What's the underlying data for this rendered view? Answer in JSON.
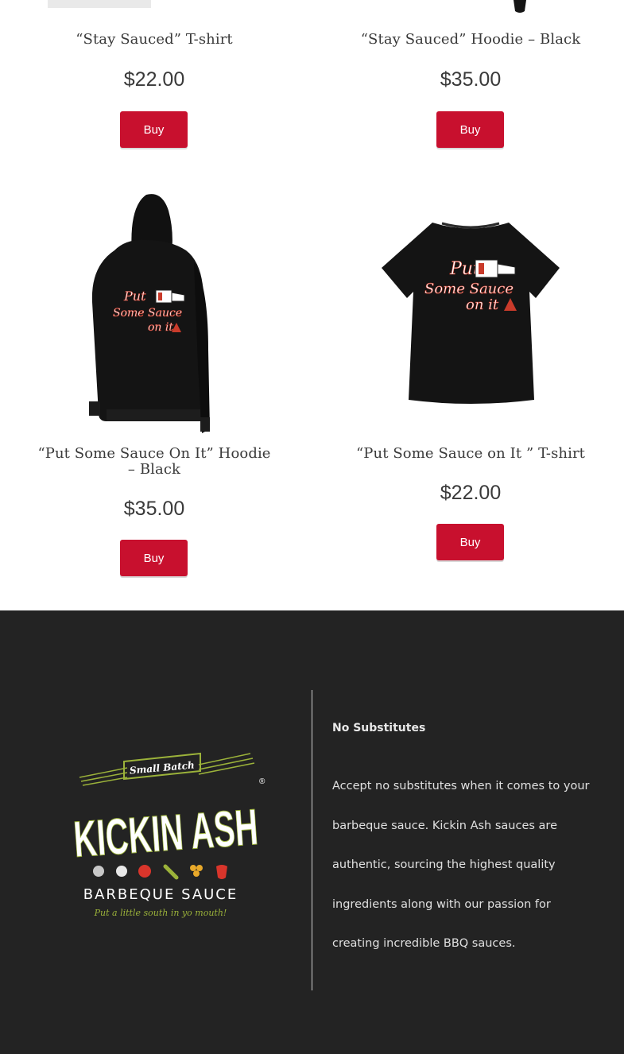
{
  "products": [
    {
      "title": "“Stay Sauced” T-shirt",
      "price": "$22.00",
      "buy_label": "Buy"
    },
    {
      "title": "“Stay Sauced” Hoodie – Black",
      "price": "$35.00",
      "buy_label": "Buy"
    },
    {
      "title": "“Put Some Sauce On It” Hoodie – Black",
      "price": "$35.00",
      "buy_label": "Buy",
      "graphic_text": [
        "Put",
        "Some Sauce",
        "on it"
      ]
    },
    {
      "title": "“Put Some Sauce on It ” T-shirt",
      "price": "$22.00",
      "buy_label": "Buy",
      "graphic_text": [
        "Put",
        "Some Sauce",
        "on it"
      ]
    }
  ],
  "footer": {
    "heading": "No Substitutes",
    "text": "Accept no substitutes when it comes to your barbeque sauce.  Kickin Ash sauces are authentic, sourcing the highest quality ingredients along with our passion for creating incredible BBQ sauces.",
    "logo": {
      "top_text": "Small Batch",
      "brand": "KICKIN ASH",
      "registered": "®",
      "subtitle": "BARBEQUE SAUCE",
      "tagline": "Put a little south in yo mouth!"
    }
  },
  "colors": {
    "accent": "#c8102e",
    "footer_bg": "#232323",
    "logo_green": "#9bb23a"
  }
}
